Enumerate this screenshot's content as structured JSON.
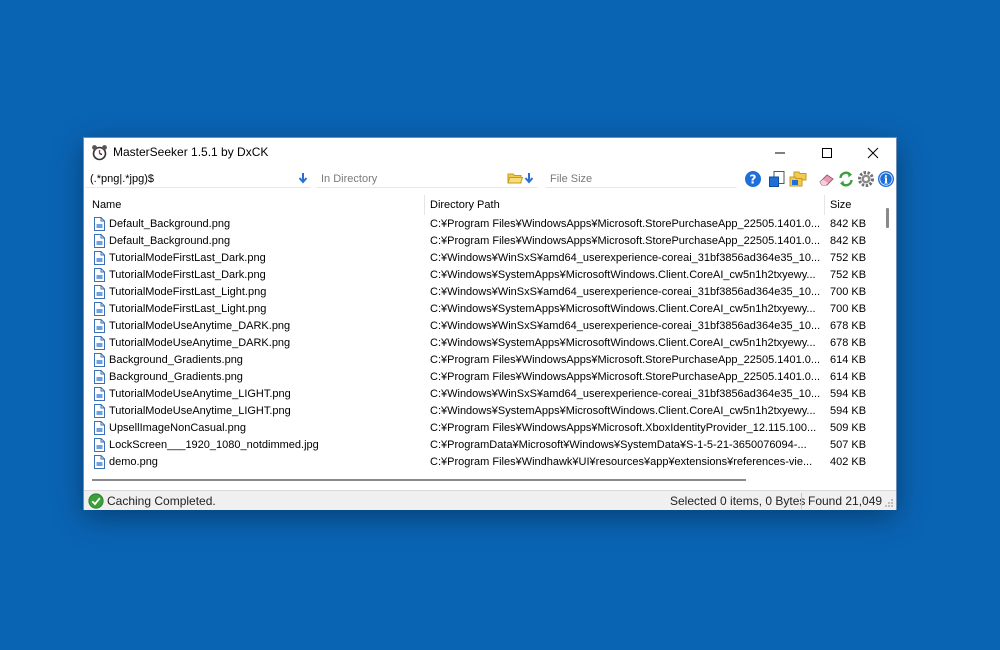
{
  "window": {
    "title": "MasterSeeker 1.5.1 by DxCK"
  },
  "toolbar": {
    "search_value": "(.*png|.*jpg)$",
    "directory_placeholder": "In Directory",
    "size_placeholder": "File Size"
  },
  "columns": [
    "Name",
    "Directory Path",
    "Size"
  ],
  "rows": [
    {
      "name": "Default_Background.png",
      "path": "C:¥Program Files¥WindowsApps¥Microsoft.StorePurchaseApp_22505.1401.0...",
      "size": "842 KB"
    },
    {
      "name": "Default_Background.png",
      "path": "C:¥Program Files¥WindowsApps¥Microsoft.StorePurchaseApp_22505.1401.0...",
      "size": "842 KB"
    },
    {
      "name": "TutorialModeFirstLast_Dark.png",
      "path": "C:¥Windows¥WinSxS¥amd64_userexperience-coreai_31bf3856ad364e35_10....",
      "size": "752 KB"
    },
    {
      "name": "TutorialModeFirstLast_Dark.png",
      "path": "C:¥Windows¥SystemApps¥MicrosoftWindows.Client.CoreAI_cw5n1h2txyewy...",
      "size": "752 KB"
    },
    {
      "name": "TutorialModeFirstLast_Light.png",
      "path": "C:¥Windows¥WinSxS¥amd64_userexperience-coreai_31bf3856ad364e35_10....",
      "size": "700 KB"
    },
    {
      "name": "TutorialModeFirstLast_Light.png",
      "path": "C:¥Windows¥SystemApps¥MicrosoftWindows.Client.CoreAI_cw5n1h2txyewy...",
      "size": "700 KB"
    },
    {
      "name": "TutorialModeUseAnytime_DARK.png",
      "path": "C:¥Windows¥WinSxS¥amd64_userexperience-coreai_31bf3856ad364e35_10....",
      "size": "678 KB"
    },
    {
      "name": "TutorialModeUseAnytime_DARK.png",
      "path": "C:¥Windows¥SystemApps¥MicrosoftWindows.Client.CoreAI_cw5n1h2txyewy...",
      "size": "678 KB"
    },
    {
      "name": "Background_Gradients.png",
      "path": "C:¥Program Files¥WindowsApps¥Microsoft.StorePurchaseApp_22505.1401.0...",
      "size": "614 KB"
    },
    {
      "name": "Background_Gradients.png",
      "path": "C:¥Program Files¥WindowsApps¥Microsoft.StorePurchaseApp_22505.1401.0...",
      "size": "614 KB"
    },
    {
      "name": "TutorialModeUseAnytime_LIGHT.png",
      "path": "C:¥Windows¥WinSxS¥amd64_userexperience-coreai_31bf3856ad364e35_10....",
      "size": "594 KB"
    },
    {
      "name": "TutorialModeUseAnytime_LIGHT.png",
      "path": "C:¥Windows¥SystemApps¥MicrosoftWindows.Client.CoreAI_cw5n1h2txyewy...",
      "size": "594 KB"
    },
    {
      "name": "UpsellImageNonCasual.png",
      "path": "C:¥Program Files¥WindowsApps¥Microsoft.XboxIdentityProvider_12.115.100...",
      "size": "509 KB"
    },
    {
      "name": "LockScreen___1920_1080_notdimmed.jpg",
      "path": "C:¥ProgramData¥Microsoft¥Windows¥SystemData¥S-1-5-21-3650076094-...",
      "size": "507 KB"
    },
    {
      "name": "demo.png",
      "path": "C:¥Program Files¥Windhawk¥UI¥resources¥app¥extensions¥references-vie...",
      "size": "402 KB"
    }
  ],
  "status": {
    "message": "Caching Completed.",
    "selected": "Selected 0 items, 0 Bytes",
    "found": "Found 21,049"
  },
  "icons": {
    "app": "alarm-clock-icon",
    "search_dropdown": "arrow-down-icon",
    "directory_browse": "folder-open-icon",
    "toolbar": [
      "help-icon",
      "select-all-icon",
      "folder-copy-icon",
      "eraser-icon",
      "refresh-icon",
      "settings-icon",
      "info-icon"
    ],
    "status": "check-circle-icon"
  },
  "colors": {
    "desktop": "#0a64b4",
    "accent_blue": "#1e6fd8",
    "status_green": "#3aa13a"
  }
}
